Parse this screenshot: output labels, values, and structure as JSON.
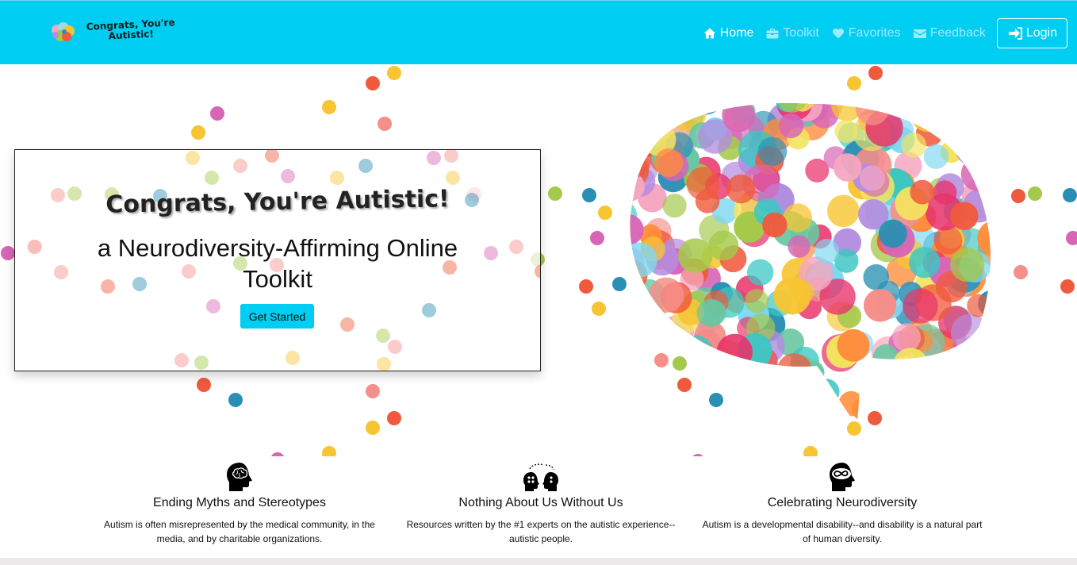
{
  "nav": {
    "brand_text": "Congrats, You're Autistic!",
    "items": [
      {
        "label": "Home",
        "icon": "home-icon",
        "active": true
      },
      {
        "label": "Toolkit",
        "icon": "briefcase-icon",
        "active": false
      },
      {
        "label": "Favorites",
        "icon": "heart-icon",
        "active": false
      },
      {
        "label": "Feedback",
        "icon": "envelope-icon",
        "active": false
      }
    ],
    "login_label": "Login"
  },
  "hero": {
    "title": "Congrats, You're Autistic!",
    "subtitle": "a Neurodiversity-Affirming Online Toolkit",
    "cta_label": "Get Started"
  },
  "features": [
    {
      "icon": "head-brain-icon",
      "title": "Ending Myths and Stereotypes",
      "text": "Autism is often misrepresented by the medical community, in the media, and by charitable organizations."
    },
    {
      "icon": "two-heads-icon",
      "title": "Nothing About Us Without Us",
      "text": "Resources written by the #1 experts on the autistic experience--autistic people."
    },
    {
      "icon": "head-infinity-icon",
      "title": "Celebrating Neurodiversity",
      "text": "Autism is a developmental disability--and disability is a natural part of human diversity."
    }
  ],
  "colors": {
    "navbar": "#00cdf2",
    "button": "#00cdf2",
    "confetti": [
      "#f05a3c",
      "#f7c531",
      "#d866b6",
      "#2a8fb4",
      "#a4c94b",
      "#f58f8a"
    ]
  }
}
